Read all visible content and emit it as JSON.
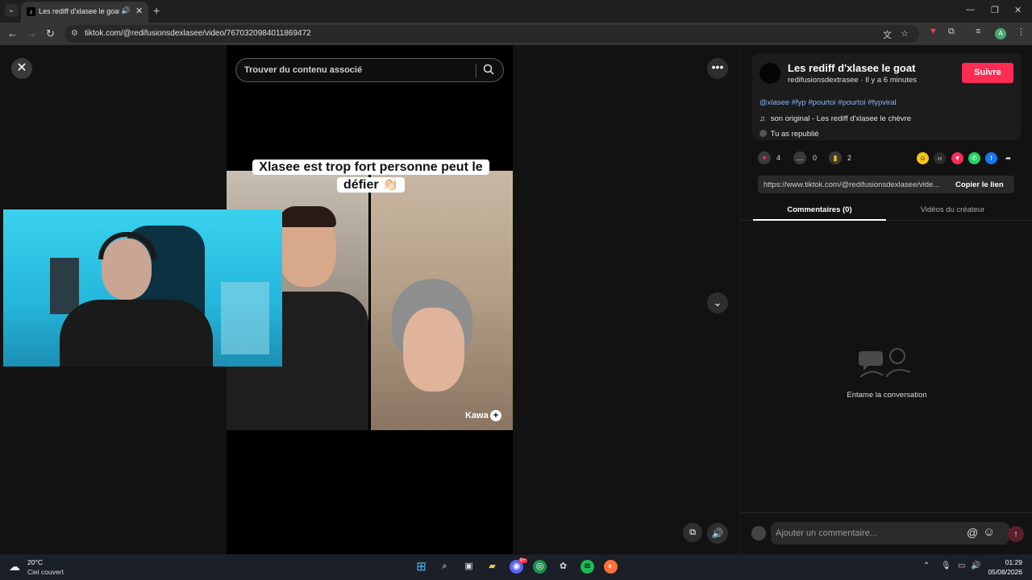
{
  "browser": {
    "tab_title": "Les rediff d'xlasee le goat (",
    "url": "tiktok.com/@redifusionsdexlasee/video/7670320984011869472"
  },
  "video": {
    "search_placeholder": "Trouver du contenu associé",
    "caption": "Xlasee est trop fort personne peut le défier 👏🏻",
    "creator_tag": "Kawa"
  },
  "author": {
    "name": "Les rediff d'xlasee le goat",
    "subline": "redifusionsdextrasee · Il y a 6 minutes",
    "follow_label": "Suivre"
  },
  "description": {
    "hashtags": "@xlasee #fyp #pourtoi #pourtoi #fypviral",
    "sound": "son original - Les rediff d'xlasee le chèvre",
    "repost": "Tu as republié"
  },
  "stats": {
    "likes": "4",
    "comments": "0",
    "saves": "2"
  },
  "link": {
    "url": "https://www.tiktok.com/@redifusionsdexlasee/vide...",
    "copy_label": "Copier le lien"
  },
  "tabs": {
    "comments": "Commentaires (0)",
    "creator_videos": "Vidéos du créateur"
  },
  "empty": {
    "text": "Entame la conversation"
  },
  "comment_box": {
    "placeholder": "Ajouter un commentaire..."
  },
  "taskbar": {
    "temp": "20°C",
    "weather": "Ciel couvert",
    "time": "01:29",
    "date": "05/08/2026",
    "discord_badge": "9+"
  },
  "colors": {
    "accent": "#fe2c55",
    "hashtag": "#8ab4f8"
  }
}
